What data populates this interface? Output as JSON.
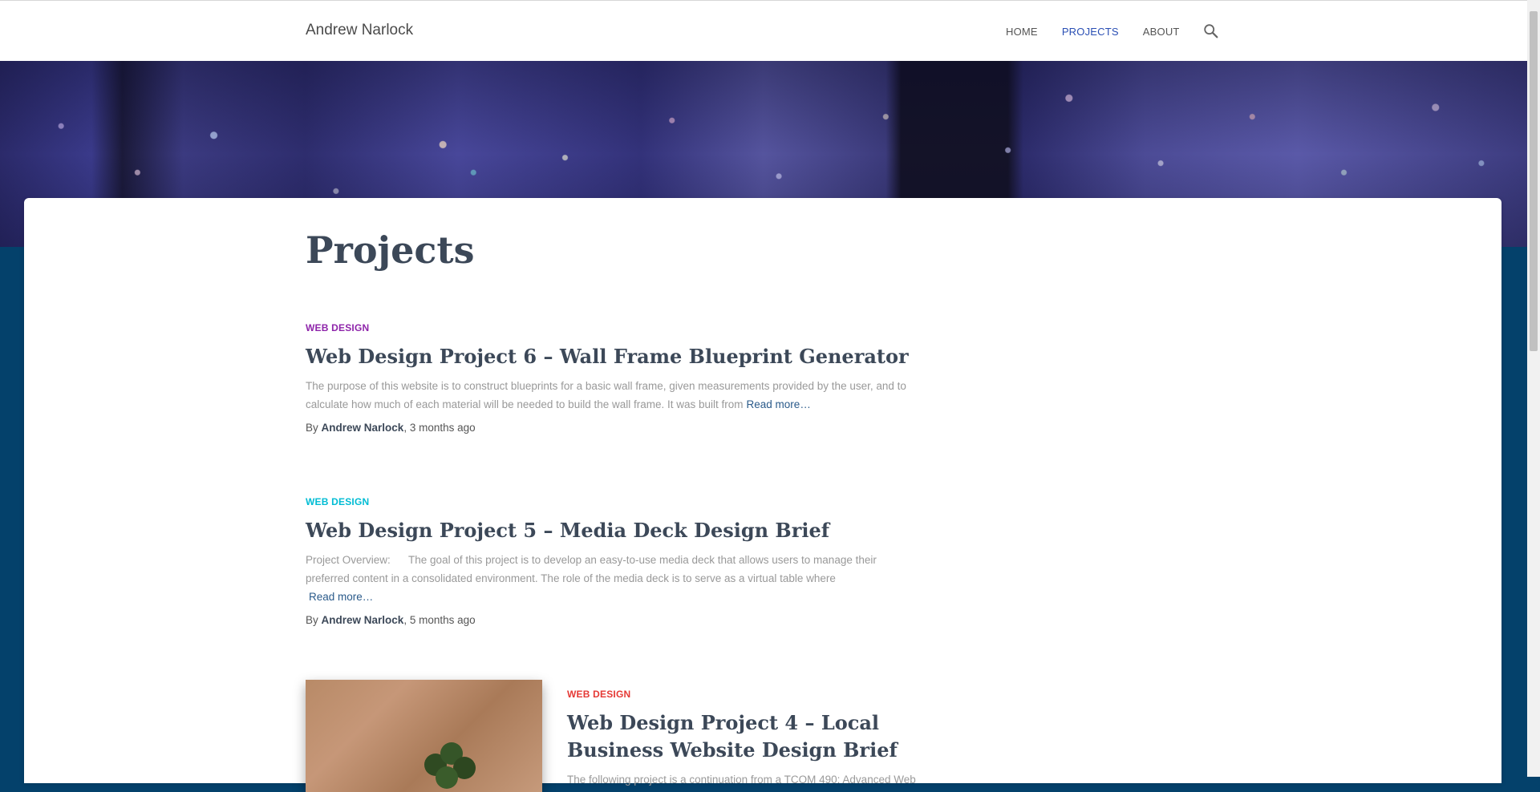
{
  "brand": "Andrew Narlock",
  "nav": {
    "items": [
      {
        "label": "HOME"
      },
      {
        "label": "PROJECTS"
      },
      {
        "label": "ABOUT"
      }
    ],
    "search_icon": "search-icon"
  },
  "page": {
    "title": "Projects"
  },
  "posts": [
    {
      "category": "WEB DESIGN",
      "category_color": "#8e24aa",
      "title": "Web Design Project 6 – Wall Frame Blueprint Generator",
      "excerpt": "The purpose of this website is to construct blueprints for a basic wall frame, given measurements provided by the user, and to calculate how much of each material will be needed to build the wall frame. It was built from",
      "read_more": "Read more…",
      "byline_prefix": "By",
      "author": "Andrew Narlock",
      "time": ", 3 months ago"
    },
    {
      "category": "WEB DESIGN",
      "category_color": "#00bcd4",
      "title": "Web Design Project 5 – Media Deck Design Brief",
      "excerpt": "Project Overview:      The goal of this project is to develop an easy-to-use media deck that allows users to manage their preferred content in a consolidated environment. The role of the media deck is to serve as a virtual table where",
      "read_more": "Read more…",
      "byline_prefix": "By",
      "author": "Andrew Narlock",
      "time": ", 5 months ago"
    },
    {
      "category": "WEB DESIGN",
      "category_color": "#e53935",
      "title": "Web Design Project 4 – Local Business Website Design Brief",
      "excerpt": "The following project is a continuation from a TCOM 490: Advanced Web"
    }
  ]
}
